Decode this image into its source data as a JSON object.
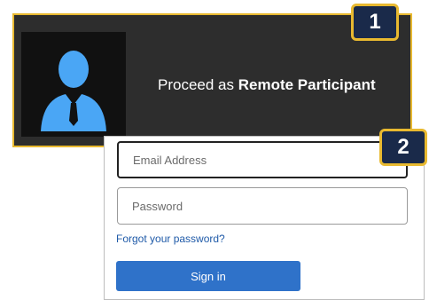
{
  "participant_panel": {
    "prefix": "Proceed as ",
    "role": "Remote Participant",
    "avatar_icon": "user-avatar-icon"
  },
  "steps": {
    "one": "1",
    "two": "2"
  },
  "login": {
    "email_placeholder": "Email Address",
    "password_placeholder": "Password",
    "forgot_label": "Forgot your password?",
    "signin_label": "Sign in"
  },
  "colors": {
    "panel_bg": "#2d2d2d",
    "highlight_border": "#e8b930",
    "badge_bg": "#1a2a4a",
    "avatar_blue": "#4aa6f5",
    "button_blue": "#2f72c9",
    "link_blue": "#1f5aa8"
  }
}
